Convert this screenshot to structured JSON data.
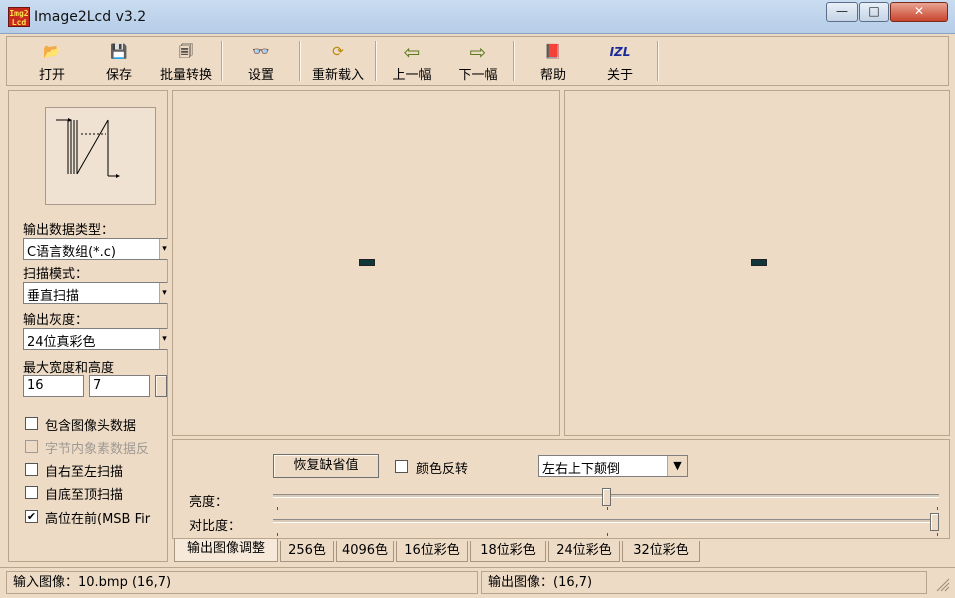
{
  "window": {
    "title": "Image2Lcd v3.2",
    "icon_text": "Img2 Lcd",
    "controls": {
      "minimize": "—",
      "maximize": "□",
      "close": "✕"
    }
  },
  "toolbar": {
    "items": [
      {
        "label": "打开",
        "icon": "open-folder-icon",
        "glyph": "📂"
      },
      {
        "label": "保存",
        "icon": "floppy-disk-icon",
        "glyph": "💾"
      },
      {
        "label": "批量转换",
        "icon": "batch-convert-icon",
        "glyph": "🗐"
      },
      {
        "label": "设置",
        "icon": "glasses-icon",
        "glyph": "👓"
      },
      {
        "label": "重新载入",
        "icon": "reload-icon",
        "glyph": "⟳"
      },
      {
        "label": "上一幅",
        "icon": "arrow-left-icon",
        "glyph": "⇦"
      },
      {
        "label": "下一幅",
        "icon": "arrow-right-icon",
        "glyph": "⇨"
      },
      {
        "label": "帮助",
        "icon": "help-book-icon",
        "glyph": "📕"
      },
      {
        "label": "关于",
        "icon": "izl-logo-icon",
        "glyph": "IZL"
      }
    ]
  },
  "settings": {
    "output_type_label": "输出数据类型：",
    "output_type_value": "C语言数组(*.c)",
    "scan_mode_label": "扫描模式：",
    "scan_mode_value": "垂直扫描",
    "gray_label": "输出灰度：",
    "gray_value": "24位真彩色",
    "size_label": "最大宽度和高度",
    "max_width": "16",
    "max_height": "7",
    "checkboxes": [
      {
        "label": "包含图像头数据",
        "checked": false,
        "enabled": true
      },
      {
        "label": "字节内象素数据反",
        "checked": false,
        "enabled": false
      },
      {
        "label": "自右至左扫描",
        "checked": false,
        "enabled": true
      },
      {
        "label": "自底至顶扫描",
        "checked": false,
        "enabled": true
      },
      {
        "label": "高位在前(MSB Fir",
        "checked": true,
        "enabled": true
      }
    ]
  },
  "adjust": {
    "restore_button": "恢复缺省值",
    "invert_label": "颜色反转",
    "invert_checked": false,
    "flip_value": "左右上下颠倒",
    "brightness_label": "亮度：",
    "brightness_level": 0.5,
    "contrast_label": "对比度：",
    "contrast_level": 1.0
  },
  "tabs": [
    "输出图像调整",
    "256色",
    "4096色",
    "16位彩色",
    "18位彩色",
    "24位彩色",
    "32位彩色"
  ],
  "status": {
    "input": "输入图像：10.bmp (16,7)",
    "output": "输出图像：(16,7)"
  },
  "colors": {
    "background": "#eddbc6",
    "titlebar": "#c9dcf0",
    "close_button": "#c9452d",
    "thumbnail": "#10383a"
  }
}
